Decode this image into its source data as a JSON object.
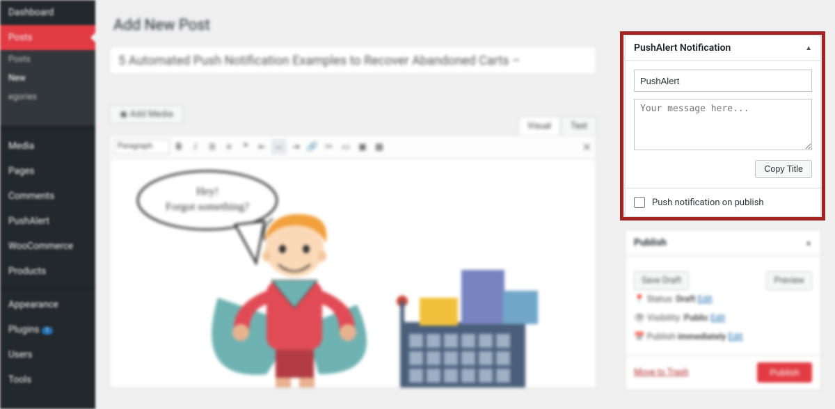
{
  "sidebar": {
    "dashboard": "Dashboard",
    "posts": "Posts",
    "sub_posts": "Posts",
    "sub_new": "New",
    "sub_categories": "egories",
    "media": "Media",
    "pages": "Pages",
    "comments": "Comments",
    "pushalert": "PushAlert",
    "woocommerce": "WooCommerce",
    "products": "Products",
    "appearance": "Appearance",
    "plugins": "Plugins",
    "users": "Users",
    "tools": "Tools"
  },
  "page": {
    "title": "Add New Post",
    "post_title": "5 Automated Push Notification Examples to Recover Abandoned Carts –",
    "add_media": "Add Media",
    "tabs": {
      "visual": "Visual",
      "text": "Text"
    },
    "paragraph": "Paragraph"
  },
  "speech": {
    "line1": "Hey!",
    "line2": "Forgot something?"
  },
  "pushalert": {
    "panel_title": "PushAlert Notification",
    "input_value": "PushAlert",
    "textarea_placeholder": "Your message here...",
    "copy_title": "Copy Title",
    "push_on_publish": "Push notification on publish"
  },
  "publish": {
    "title": "Publish",
    "save_draft": "Save Draft",
    "preview": "Preview",
    "status_label": "Status:",
    "status_value": "Draft",
    "visibility_label": "Visibility:",
    "visibility_value": "Public",
    "publish_label": "Publish",
    "publish_value": "immediately",
    "edit": "Edit",
    "move_to_trash": "Move to Trash",
    "publish_btn": "Publish"
  }
}
